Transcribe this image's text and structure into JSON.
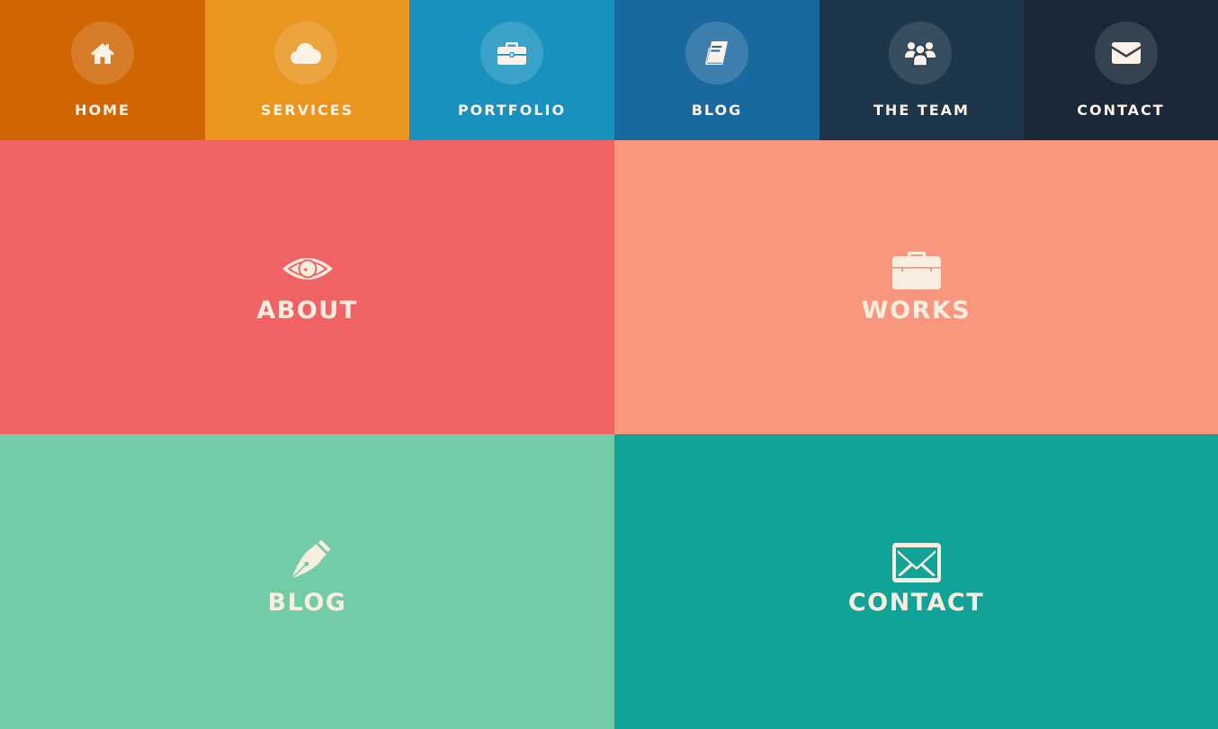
{
  "nav": {
    "items": [
      {
        "label": "HOME",
        "icon": "home-icon",
        "bg": "#d06503"
      },
      {
        "label": "SERVICES",
        "icon": "cloud-icon",
        "bg": "#e9951e"
      },
      {
        "label": "PORTFOLIO",
        "icon": "briefcase-icon",
        "bg": "#1891bf"
      },
      {
        "label": "BLOG",
        "icon": "book-icon",
        "bg": "#1a68a0"
      },
      {
        "label": "THE TEAM",
        "icon": "group-icon",
        "bg": "#1d364a"
      },
      {
        "label": "CONTACT",
        "icon": "envelope-icon",
        "bg": "#1a2838"
      }
    ]
  },
  "tiles": {
    "about": {
      "label": "ABOUT",
      "icon": "eye-icon",
      "bg": "#f06263"
    },
    "works": {
      "label": "WORKS",
      "icon": "briefcase-icon",
      "bg": "#f8977d"
    },
    "blog": {
      "label": "BLOG",
      "icon": "pen-nib-icon",
      "bg": "#73cca8"
    },
    "contact": {
      "label": "CONTACT",
      "icon": "envelope-icon",
      "bg": "#12a398"
    }
  },
  "colors": {
    "label_text": "#fdf2e7",
    "tile_text": "#f7eee0"
  }
}
